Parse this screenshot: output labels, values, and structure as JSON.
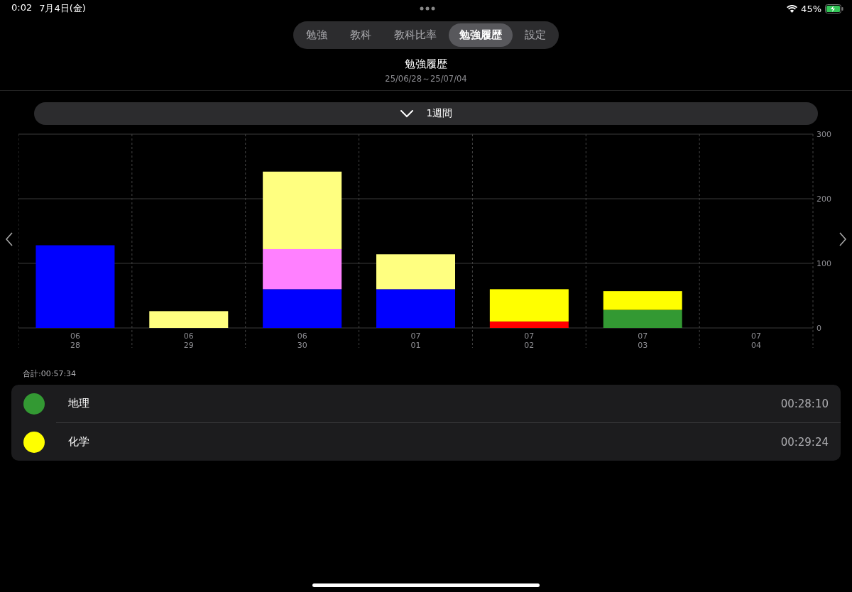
{
  "status_bar": {
    "time": "0:02",
    "date": "7月4日(金)",
    "battery": "45%"
  },
  "tabs": [
    {
      "label": "勉強",
      "selected": false
    },
    {
      "label": "教科",
      "selected": false
    },
    {
      "label": "教科比率",
      "selected": false
    },
    {
      "label": "勉強履歴",
      "selected": true
    },
    {
      "label": "設定",
      "selected": false
    }
  ],
  "header": {
    "title": "勉強履歴",
    "date_range": "25/06/28～25/07/04"
  },
  "period_selector": {
    "label": "1週間"
  },
  "chart_data": {
    "type": "bar",
    "stacked": true,
    "categories": [
      "06\n28",
      "06\n29",
      "06\n30",
      "07\n01",
      "07\n02",
      "07\n03",
      "07\n04"
    ],
    "ylim": [
      0,
      300
    ],
    "yticks": [
      0,
      100,
      200,
      300
    ],
    "series": [
      {
        "color": "#0000ff",
        "values": [
          128,
          null,
          60,
          60,
          null,
          null,
          null
        ]
      },
      {
        "color": "#ff0000",
        "values": [
          null,
          null,
          null,
          null,
          10,
          null,
          null
        ]
      },
      {
        "color": "#339933",
        "values": [
          null,
          null,
          null,
          null,
          null,
          28,
          null
        ]
      },
      {
        "color": "#ff80ff",
        "values": [
          null,
          null,
          62,
          null,
          null,
          null,
          null
        ]
      },
      {
        "color": "#ffff80",
        "values": [
          null,
          26,
          120,
          54,
          null,
          null,
          null
        ]
      },
      {
        "color": "#ffff00",
        "values": [
          null,
          null,
          null,
          null,
          50,
          29,
          null
        ]
      }
    ]
  },
  "total": "合計:00:57:34",
  "subjects": [
    {
      "name": "地理",
      "time": "00:28:10",
      "color": "#339933"
    },
    {
      "name": "化学",
      "time": "00:29:24",
      "color": "#ffff00"
    }
  ]
}
